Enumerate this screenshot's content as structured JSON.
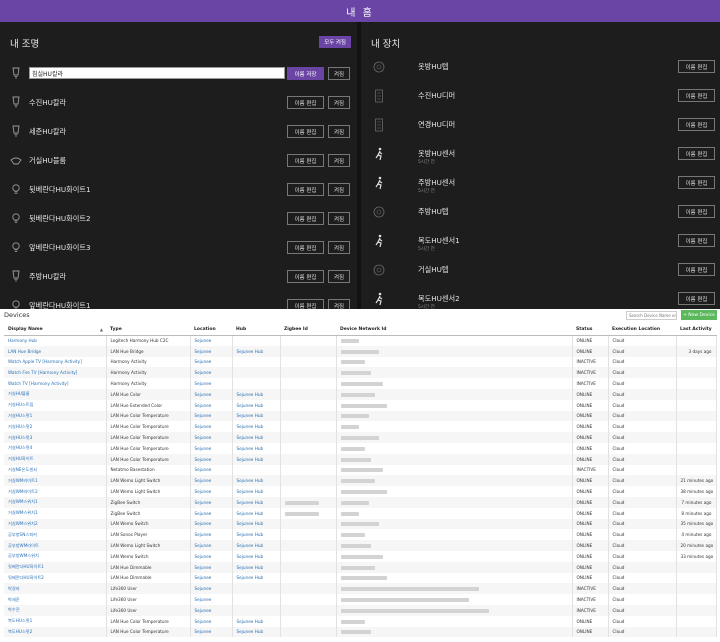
{
  "app_title": "내 홈",
  "lights_panel": {
    "title": "내 조명",
    "all_on_label": "모두 켜짐",
    "input_value": "침실HU칼라",
    "save_label": "이름 저장",
    "edit_label": "이름 편집",
    "on_label": "켜짐",
    "items": [
      {
        "label": "수진HU칼라",
        "icon": "spotlight-icon"
      },
      {
        "label": "세준HU칼라",
        "icon": "spotlight-icon"
      },
      {
        "label": "거실HU블룸",
        "icon": "bloom-lamp-icon"
      },
      {
        "label": "뒷베란다HU화이트1",
        "icon": "bulb-icon"
      },
      {
        "label": "뒷베란다HU화이트2",
        "icon": "bulb-icon"
      },
      {
        "label": "앞베란다HU화이트3",
        "icon": "bulb-icon"
      },
      {
        "label": "주방HU칼라",
        "icon": "spotlight-icon"
      },
      {
        "label": "앞베란다HU화이트1",
        "icon": "bulb-icon"
      }
    ]
  },
  "devices_panel": {
    "title": "내 장치",
    "edit_label": "이름 편집",
    "items": [
      {
        "label": "옷방HU텝",
        "sub": "",
        "icon": "hub-icon"
      },
      {
        "label": "수진HU디머",
        "sub": "",
        "icon": "dimmer-icon"
      },
      {
        "label": "연경HU디머",
        "sub": "",
        "icon": "dimmer-icon"
      },
      {
        "label": "옷방HU센서",
        "sub": "5시간 전",
        "icon": "motion-sensor-icon"
      },
      {
        "label": "주방HU센서",
        "sub": "5시간 전",
        "icon": "motion-sensor-icon"
      },
      {
        "label": "주방HU텝",
        "sub": "",
        "icon": "hub-icon"
      },
      {
        "label": "복도HU센서1",
        "sub": "5시간 전",
        "icon": "motion-sensor-icon"
      },
      {
        "label": "거실HU텝",
        "sub": "",
        "icon": "hub-icon"
      },
      {
        "label": "복도HU센서2",
        "sub": "5시간 전",
        "icon": "motion-sensor-icon"
      }
    ]
  },
  "devices_list": {
    "title": "Devices",
    "search_placeholder": "Search Device Name or ...",
    "new_device_label": "+ New Device",
    "columns": [
      "Display Name",
      "Type",
      "Location",
      "Hub",
      "Zigbee Id",
      "Device Network Id",
      "Status",
      "Execution Location",
      "Last Activity"
    ],
    "rows": [
      {
        "name": "Harmony Hub",
        "type": "Logitech Harmony Hub C2C",
        "location": "Sejunee",
        "hub": "",
        "status": "ONLINE",
        "exec": "Cloud",
        "last": ""
      },
      {
        "name": "LAN Hue Bridge",
        "type": "LAN Hue Bridge",
        "location": "Sejunee",
        "hub": "Sejunee Hub",
        "status": "ONLINE",
        "exec": "Cloud",
        "last": "3 days ago"
      },
      {
        "name": "Watch Apple TV [Harmony Activity]",
        "type": "Harmony Activity",
        "location": "Sejunee",
        "hub": "",
        "status": "INACTIVE",
        "exec": "Cloud",
        "last": ""
      },
      {
        "name": "Watch Fire TV [Harmony Activity]",
        "type": "Harmony Activity",
        "location": "Sejunee",
        "hub": "",
        "status": "INACTIVE",
        "exec": "Cloud",
        "last": ""
      },
      {
        "name": "Watch TV [Harmony Activity]",
        "type": "Harmony Activity",
        "location": "Sejunee",
        "hub": "",
        "status": "INACTIVE",
        "exec": "Cloud",
        "last": ""
      },
      {
        "name": "거실HU블룸",
        "type": "LAN Hue Color",
        "location": "Sejunee",
        "hub": "Sejunee Hub",
        "status": "ONLINE",
        "exec": "Cloud",
        "last": ""
      },
      {
        "name": "거실HU스트립",
        "type": "LAN Hue Extended Color",
        "location": "Sejunee",
        "hub": "Sejunee Hub",
        "status": "ONLINE",
        "exec": "Cloud",
        "last": ""
      },
      {
        "name": "거실HU스팟1",
        "type": "LAN Hue Color Temperature",
        "location": "Sejunee",
        "hub": "Sejunee Hub",
        "status": "ONLINE",
        "exec": "Cloud",
        "last": ""
      },
      {
        "name": "거실HU스팟2",
        "type": "LAN Hue Color Temperature",
        "location": "Sejunee",
        "hub": "Sejunee Hub",
        "status": "ONLINE",
        "exec": "Cloud",
        "last": ""
      },
      {
        "name": "거실HU스팟3",
        "type": "LAN Hue Color Temperature",
        "location": "Sejunee",
        "hub": "Sejunee Hub",
        "status": "ONLINE",
        "exec": "Cloud",
        "last": ""
      },
      {
        "name": "거실HU스팟4",
        "type": "LAN Hue Color Temperature",
        "location": "Sejunee",
        "hub": "Sejunee Hub",
        "status": "ONLINE",
        "exec": "Cloud",
        "last": ""
      },
      {
        "name": "거실HU화이트",
        "type": "LAN Hue Color Temperature",
        "location": "Sejunee",
        "hub": "Sejunee Hub",
        "status": "ONLINE",
        "exec": "Cloud",
        "last": ""
      },
      {
        "name": "거실NE온도센서",
        "type": "Netatmo Basestation",
        "location": "Sejunee",
        "hub": "",
        "status": "INACTIVE",
        "exec": "Cloud",
        "last": ""
      },
      {
        "name": "거실WM라이트1",
        "type": "LAN Wemo Light Switch",
        "location": "Sejunee",
        "hub": "Sejunee Hub",
        "status": "ONLINE",
        "exec": "Cloud",
        "last": "21 minutes ago"
      },
      {
        "name": "거실WM라이트2",
        "type": "LAN Wemo Light Switch",
        "location": "Sejunee",
        "hub": "Sejunee Hub",
        "status": "ONLINE",
        "exec": "Cloud",
        "last": "38 minutes ago"
      },
      {
        "name": "거실WM스위치1",
        "type": "ZigBee Switch",
        "location": "Sejunee",
        "hub": "Sejunee Hub",
        "status": "ONLINE",
        "exec": "Cloud",
        "last": "7 minutes ago"
      },
      {
        "name": "거실WM스위치1",
        "type": "ZigBee Switch",
        "location": "Sejunee",
        "hub": "Sejunee Hub",
        "status": "ONLINE",
        "exec": "Cloud",
        "last": "8 minutes ago"
      },
      {
        "name": "거실WM스위치2",
        "type": "LAN Wemo Switch",
        "location": "Sejunee",
        "hub": "Sejunee Hub",
        "status": "ONLINE",
        "exec": "Cloud",
        "last": "35 minutes ago"
      },
      {
        "name": "공부방SN스피커",
        "type": "LAN Sonos Player",
        "location": "Sejunee",
        "hub": "Sejunee Hub",
        "status": "ONLINE",
        "exec": "Cloud",
        "last": "4 minutes ago"
      },
      {
        "name": "공부방WM라이트",
        "type": "LAN Wemo Light Switch",
        "location": "Sejunee",
        "hub": "Sejunee Hub",
        "status": "ONLINE",
        "exec": "Cloud",
        "last": "20 minutes ago"
      },
      {
        "name": "공부방WM스위치",
        "type": "LAN Wemo Switch",
        "location": "Sejunee",
        "hub": "Sejunee Hub",
        "status": "ONLINE",
        "exec": "Cloud",
        "last": "33 minutes ago"
      },
      {
        "name": "뒷베란다HU화이트1",
        "type": "LAN Hue Dimmable",
        "location": "Sejunee",
        "hub": "Sejunee Hub",
        "status": "ONLINE",
        "exec": "Cloud",
        "last": ""
      },
      {
        "name": "뒷베란다HU화이트2",
        "type": "LAN Hue Dimmable",
        "location": "Sejunee",
        "hub": "Sejunee Hub",
        "status": "ONLINE",
        "exec": "Cloud",
        "last": ""
      },
      {
        "name": "박경자",
        "type": "Life360 User",
        "location": "Sejunee",
        "hub": "",
        "status": "INACTIVE",
        "exec": "Cloud",
        "last": ""
      },
      {
        "name": "박세준",
        "type": "Life360 User",
        "location": "Sejunee",
        "hub": "",
        "status": "INACTIVE",
        "exec": "Cloud",
        "last": ""
      },
      {
        "name": "박수진",
        "type": "Life360 User",
        "location": "Sejunee",
        "hub": "",
        "status": "INACTIVE",
        "exec": "Cloud",
        "last": ""
      },
      {
        "name": "복도HU스팟1",
        "type": "LAN Hue Color Temperature",
        "location": "Sejunee",
        "hub": "Sejunee Hub",
        "status": "ONLINE",
        "exec": "Cloud",
        "last": ""
      },
      {
        "name": "복도HU스팟2",
        "type": "LAN Hue Color Temperature",
        "location": "Sejunee",
        "hub": "Sejunee Hub",
        "status": "ONLINE",
        "exec": "Cloud",
        "last": ""
      }
    ]
  },
  "colors": {
    "accent": "#6a45a6",
    "panel_bg": "#1d1d1d",
    "link": "#2a6fb5",
    "new_button": "#5cb85c"
  }
}
